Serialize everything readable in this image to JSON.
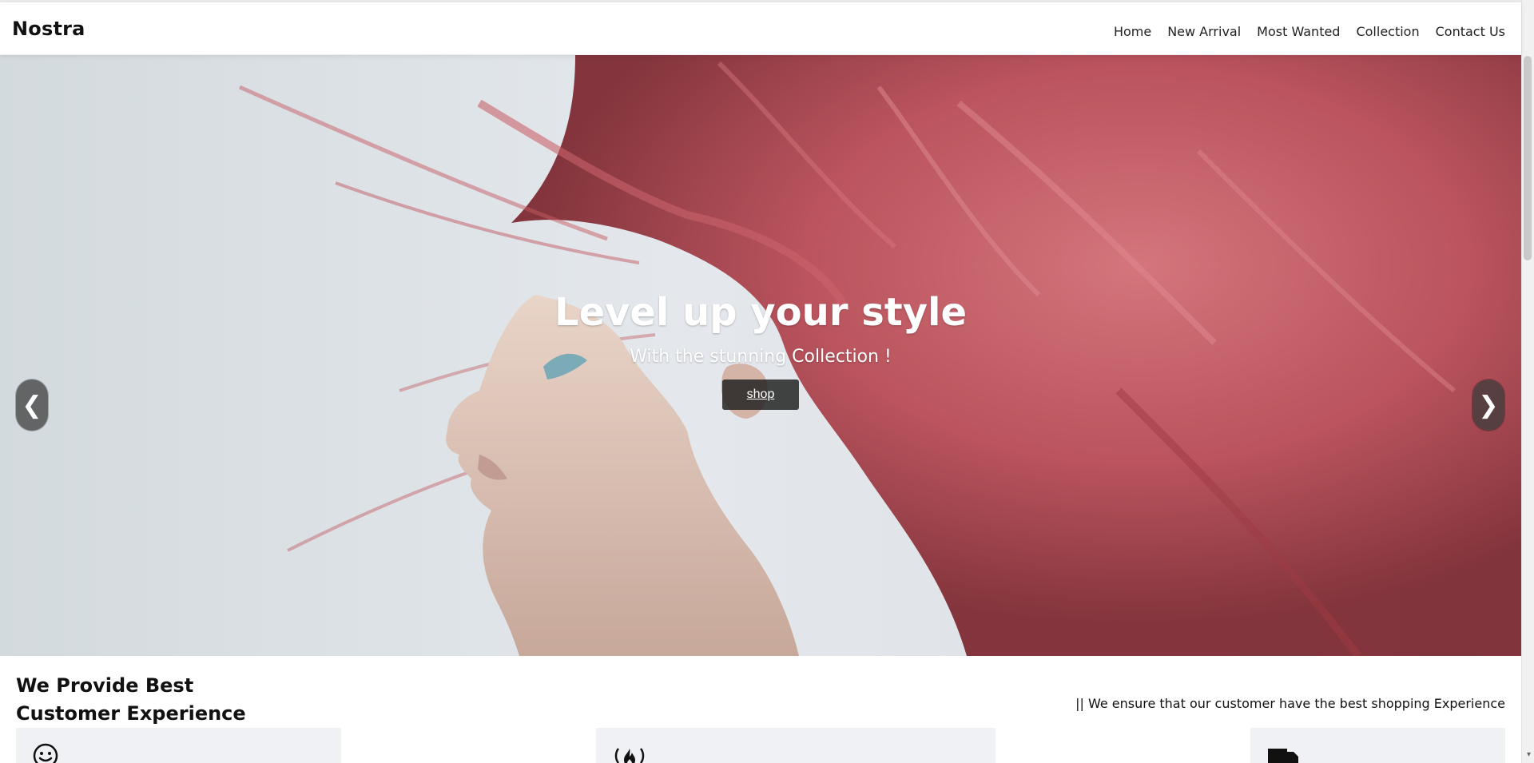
{
  "brand": {
    "name": "Nostra"
  },
  "nav": {
    "items": [
      {
        "label": "Home"
      },
      {
        "label": "New Arrival"
      },
      {
        "label": "Most Wanted"
      },
      {
        "label": "Collection"
      },
      {
        "label": "Contact Us"
      }
    ]
  },
  "hero": {
    "title": "Level up your style",
    "subtitle": "With the stunning Collection !",
    "cta_label": "shop",
    "prev_label": "❮",
    "next_label": "❯"
  },
  "features": {
    "title_line1": "We Provide Best",
    "title_line2": "Customer Experience",
    "note": "|| We ensure that our customer have the best shopping Experience",
    "cards": [
      {
        "icon": "smile-icon"
      },
      {
        "icon": "fire-icon"
      },
      {
        "icon": "truck-icon"
      }
    ]
  },
  "colors": {
    "hair": "#c85a62",
    "background": "#dfe4e8",
    "button": "#2a2a2a"
  }
}
